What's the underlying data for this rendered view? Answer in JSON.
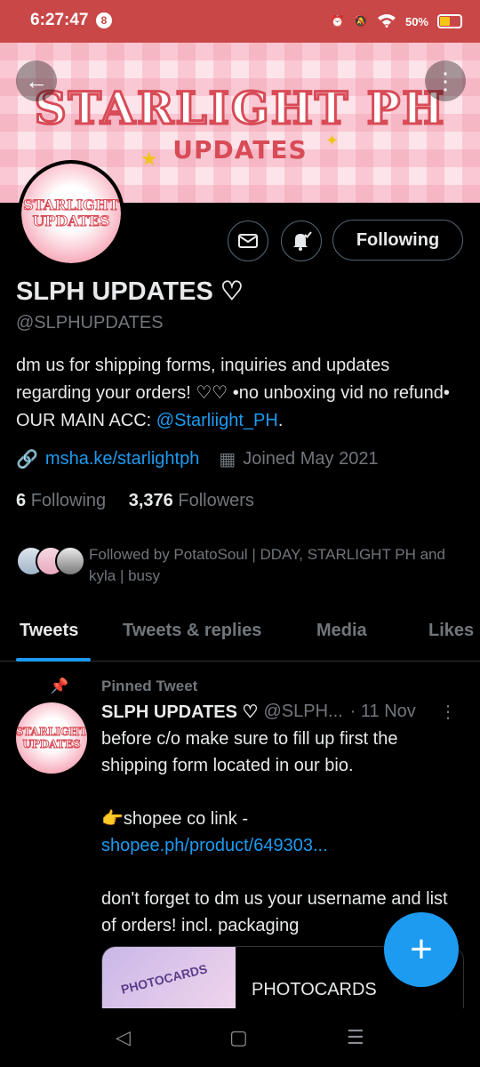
{
  "status_bar": {
    "time": "6:27:47",
    "notif_count": "8",
    "battery": "50%"
  },
  "banner": {
    "title": "STARLIGHT PH",
    "subtitle": "UPDATES"
  },
  "avatar_text": {
    "line1": "STARLIGHT",
    "line2": "UPDATES"
  },
  "actions": {
    "follow_label": "Following"
  },
  "profile": {
    "name": "SLPH UPDATES ♡",
    "handle": "@SLPHUPDATES",
    "bio_text": "dm us for shipping forms, inquiries and updates regarding your orders! ♡♡ •no unboxing vid no refund•  OUR MAIN ACC: ",
    "bio_link": "@Starliight_PH",
    "bio_end": ".",
    "url": "msha.ke/starlightph",
    "joined": "Joined May 2021",
    "following_count": "6",
    "following_label": "Following",
    "followers_count": "3,376",
    "followers_label": "Followers",
    "followed_by": "Followed by PotatoSoul | DDAY, STARLIGHT PH and kyla | busy"
  },
  "tabs": [
    "Tweets",
    "Tweets & replies",
    "Media",
    "Likes"
  ],
  "pinned_tweet": {
    "pinned_label": "Pinned Tweet",
    "author": "SLPH UPDATES ♡",
    "handle": "@SLPH...",
    "date": "· 11 Nov",
    "line1": "before c/o make sure to fill up first the shipping form located in our bio.",
    "line2_prefix": "👉shopee co link -",
    "line2_link": "shopee.ph/product/649303...",
    "line3": "don't forget to dm us your username and list of orders! incl. packaging",
    "card_thumb": "PHOTOCARDS",
    "card_title": "PHOTOCARDS"
  },
  "colors": {
    "status_bar": "#c94747",
    "accent": "#1d9bf0",
    "background": "#000000"
  }
}
